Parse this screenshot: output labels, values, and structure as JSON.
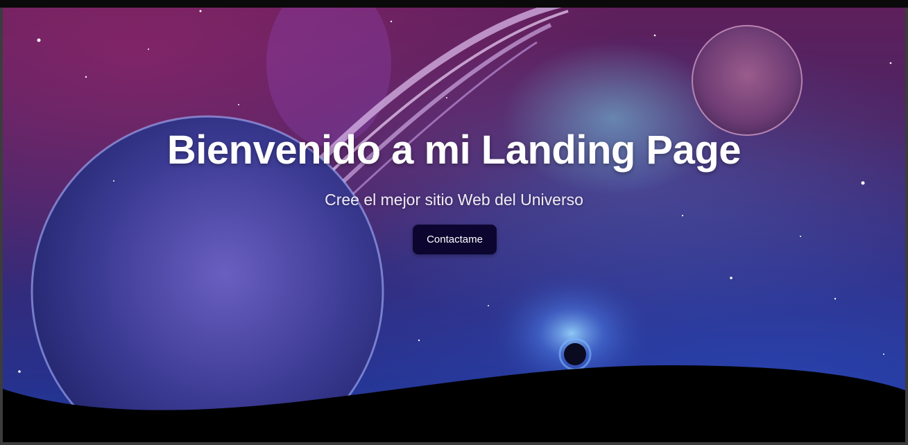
{
  "hero": {
    "title": "Bienvenido a mi Landing Page",
    "subtitle": "Cree el mejor sitio Web del Universo",
    "cta_label": "Contactame"
  },
  "colors": {
    "button_bg": "#0c0530",
    "text": "#ffffff",
    "wave": "#000000"
  }
}
